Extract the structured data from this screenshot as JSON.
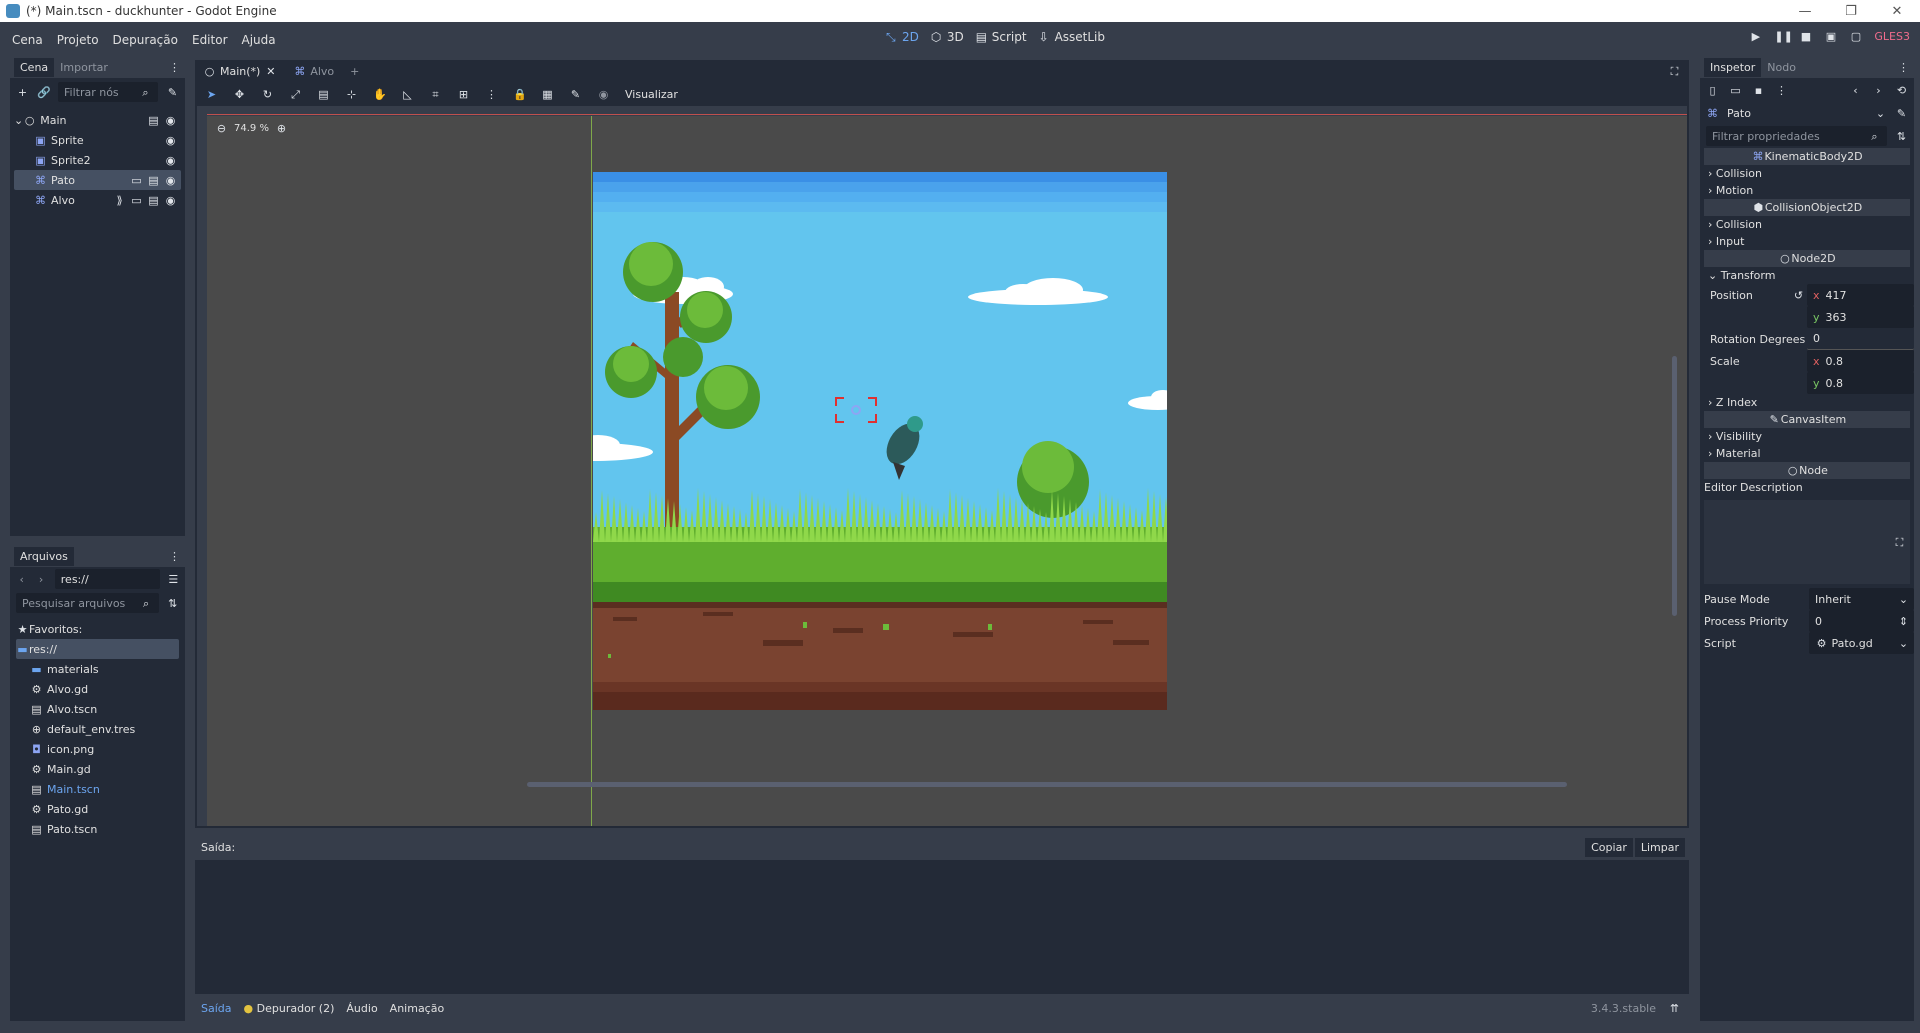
{
  "window": {
    "title": "(*) Main.tscn - duckhunter - Godot Engine",
    "controls": [
      "—",
      "❐",
      "✕"
    ]
  },
  "menu": [
    "Cena",
    "Projeto",
    "Depuração",
    "Editor",
    "Ajuda"
  ],
  "modes": [
    {
      "label": "2D",
      "icon": "2d-icon",
      "active": true
    },
    {
      "label": "3D",
      "icon": "3d-icon",
      "active": false
    },
    {
      "label": "Script",
      "icon": "script-icon",
      "active": false
    },
    {
      "label": "AssetLib",
      "icon": "assetlib-icon",
      "active": false
    }
  ],
  "renderer": "GLES3",
  "scene_dock": {
    "tabs": [
      "Cena",
      "Importar"
    ],
    "filter_placeholder": "Filtrar nós",
    "nodes": [
      {
        "label": "Main",
        "depth": 0,
        "icon": "node2d-icon",
        "selected": false
      },
      {
        "label": "Sprite",
        "depth": 1,
        "icon": "sprite-icon",
        "selected": false
      },
      {
        "label": "Sprite2",
        "depth": 1,
        "icon": "sprite-icon",
        "selected": false
      },
      {
        "label": "Pato",
        "depth": 1,
        "icon": "kinematic-icon",
        "selected": true
      },
      {
        "label": "Alvo",
        "depth": 1,
        "icon": "kinematic-icon",
        "selected": false
      }
    ]
  },
  "filesystem": {
    "title": "Arquivos",
    "path": "res://",
    "search_placeholder": "Pesquisar arquivos",
    "favorites": "Favoritos:",
    "root": "res://",
    "items": [
      "materials",
      "Alvo.gd",
      "Alvo.tscn",
      "default_env.tres",
      "icon.png",
      "Main.gd",
      "Main.tscn",
      "Pato.gd",
      "Pato.tscn"
    ],
    "highlight": "Main.tscn"
  },
  "editor_tabs": [
    {
      "label": "Main(*)",
      "active": true
    },
    {
      "label": "Alvo",
      "active": false
    }
  ],
  "viewport": {
    "zoom": "74.9 %",
    "view_menu": "Visualizar"
  },
  "output": {
    "label": "Saída:",
    "copy": "Copiar",
    "clear": "Limpar",
    "bottom_tabs": [
      "Saída",
      "Depurador (2)",
      "Áudio",
      "Animação"
    ],
    "version": "3.4.3.stable"
  },
  "inspector": {
    "tabs": [
      "Inspetor",
      "Nodo"
    ],
    "node_name": "Pato",
    "filter_placeholder": "Filtrar propriedades",
    "class1": "KinematicBody2D",
    "k_sections": [
      "Collision",
      "Motion"
    ],
    "class2": "CollisionObject2D",
    "c_sections": [
      "Collision",
      "Input"
    ],
    "class3": "Node2D",
    "transform": "Transform",
    "position_label": "Position",
    "position_x": "417",
    "position_y": "363",
    "rotation_label": "Rotation Degrees",
    "rotation": "0",
    "scale_label": "Scale",
    "scale_x": "0.8",
    "scale_y": "0.8",
    "zindex": "Z Index",
    "class4": "CanvasItem",
    "ci_sections": [
      "Visibility",
      "Material"
    ],
    "class5": "Node",
    "editor_desc": "Editor Description",
    "pause_label": "Pause Mode",
    "pause_value": "Inherit",
    "priority_label": "Process Priority",
    "priority_value": "0",
    "script_label": "Script",
    "script_value": "Pato.gd"
  },
  "colors": {
    "bg": "#363d4a",
    "panel": "#232a37",
    "accent": "#6ca5ef",
    "sky": "#62c5ee"
  }
}
